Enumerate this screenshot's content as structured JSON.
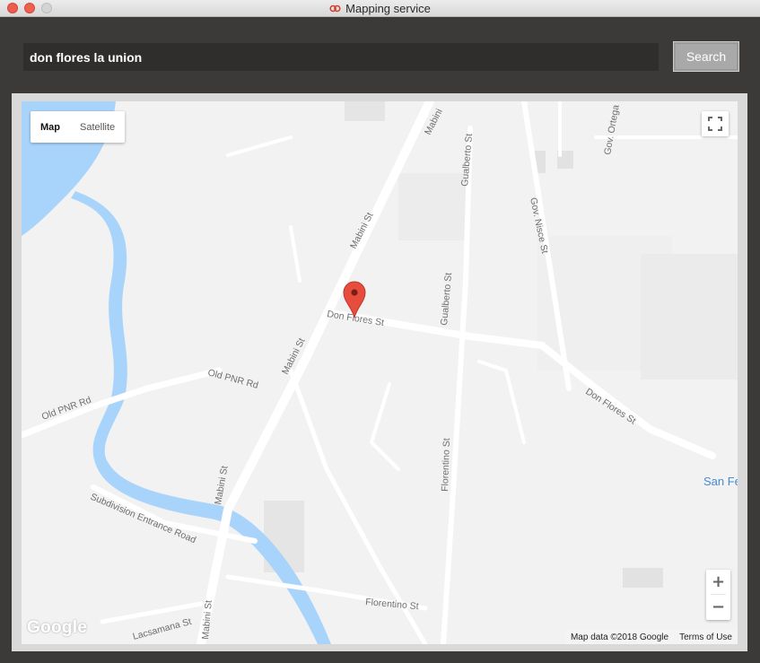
{
  "window": {
    "title": "Mapping service"
  },
  "search": {
    "query": "don flores la union",
    "button_label": "Search"
  },
  "map": {
    "type_control": {
      "map_label": "Map",
      "satellite_label": "Satellite",
      "selected": "Map"
    },
    "roads": {
      "mabini_1": "Mabini St",
      "mabini_2": "Mabini St",
      "mabini_3": "Mabini St",
      "mabini_4": "Mabini St",
      "mabini_top": "Mabini",
      "don_flores_1": "Don Flores St",
      "don_flores_2": "Don Flores St",
      "gualberto_1": "Gualberto St",
      "gualberto_2": "Gualberto St",
      "gov_nisce": "Gov. Nisce St",
      "gov_ortega": "Gov. Ortega",
      "old_pnr_1": "Old PNR Rd",
      "old_pnr_2": "Old PNR Rd",
      "subdivision": "Subdivision Entrance Road",
      "florentino_1": "Florentino St",
      "florentino_2": "Florentino St",
      "lacsamana": "Lacsamana St"
    },
    "place_label": "San Fe",
    "zoom_in": "+",
    "zoom_out": "−",
    "logo": "Google",
    "attribution": {
      "data": "Map data ©2018 Google",
      "terms": "Terms of Use"
    },
    "colors": {
      "water": "#a8d4fc",
      "land": "#f2f2f2",
      "road": "#ffffff",
      "marker": "#e84c3d"
    }
  }
}
